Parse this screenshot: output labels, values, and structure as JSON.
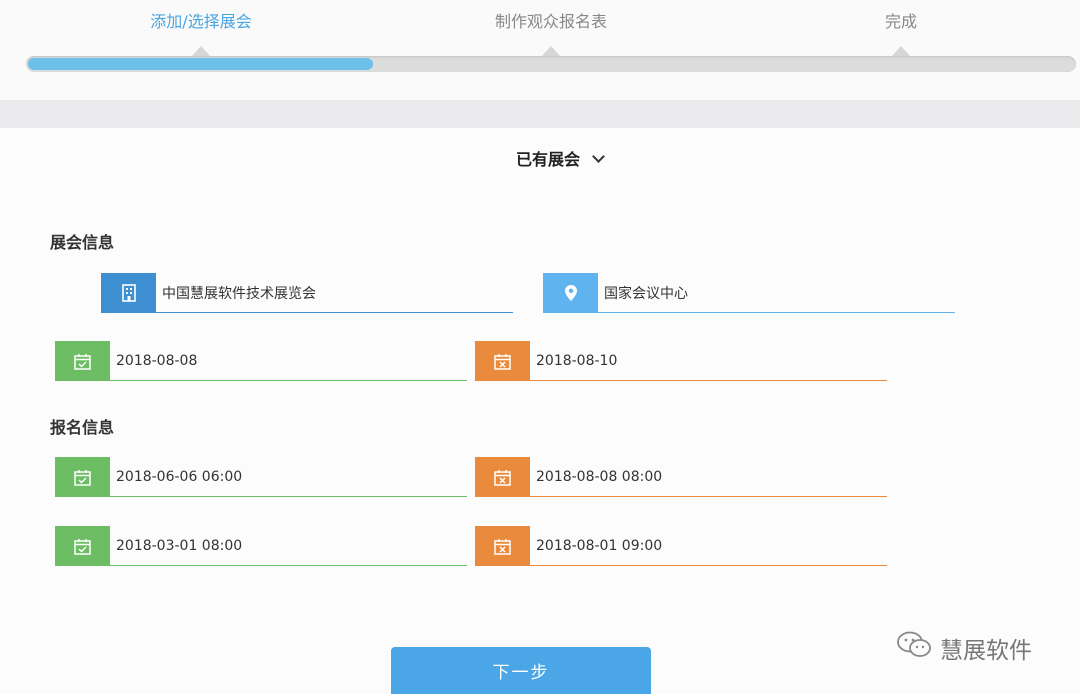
{
  "stepper": {
    "steps": [
      {
        "label": "添加/选择展会",
        "active": true
      },
      {
        "label": "制作观众报名表",
        "active": false
      },
      {
        "label": "完成",
        "active": false
      }
    ],
    "progress": 0.33
  },
  "existing_select": {
    "label": "已有展会",
    "icon": "chevron-down-icon"
  },
  "exhibition_info": {
    "title": "展会信息",
    "name": {
      "value": "中国慧展软件技术展览会",
      "icon": "building-icon"
    },
    "venue": {
      "value": "国家会议中心",
      "icon": "location-pin-icon"
    },
    "start_date": {
      "value": "2018-08-08",
      "icon": "calendar-check-icon"
    },
    "end_date": {
      "value": "2018-08-10",
      "icon": "calendar-x-icon"
    }
  },
  "registration_info": {
    "title": "报名信息",
    "reg_start": {
      "value": "2018-06-06 06:00",
      "icon": "calendar-check-icon"
    },
    "reg_end": {
      "value": "2018-08-08 08:00",
      "icon": "calendar-x-icon"
    },
    "other_start": {
      "value": "2018-03-01 08:00",
      "icon": "calendar-check-icon"
    },
    "other_end": {
      "value": "2018-08-01 09:00",
      "icon": "calendar-x-icon"
    }
  },
  "next_button": {
    "label": "下一步"
  },
  "watermark": {
    "text": "慧展软件",
    "icon": "wechat-icon"
  },
  "colors": {
    "accent": "#4aa6e6",
    "green": "#6cbd64",
    "orange": "#e98a3c",
    "blue_dark": "#3d8fd1"
  }
}
